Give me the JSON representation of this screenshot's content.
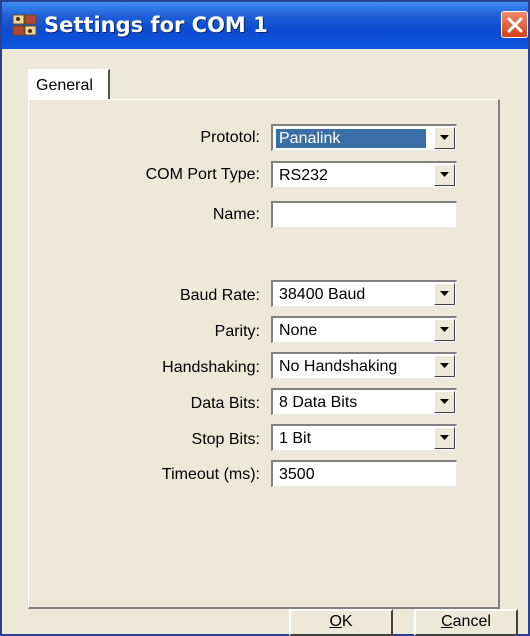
{
  "window": {
    "title": "Settings for COM 1",
    "close_icon": "close-icon",
    "app_icon": "com-port-icon"
  },
  "tabs": [
    {
      "label": "General",
      "active": true
    }
  ],
  "form": {
    "protocol": {
      "label": "Prototol:",
      "value": "Panalink",
      "selected": true
    },
    "com_port_type": {
      "label": "COM Port Type:",
      "value": "RS232"
    },
    "name": {
      "label": "Name:",
      "value": ""
    },
    "baud_rate": {
      "label": "Baud Rate:",
      "value": "38400 Baud"
    },
    "parity": {
      "label": "Parity:",
      "value": "None"
    },
    "handshaking": {
      "label": "Handshaking:",
      "value": "No Handshaking"
    },
    "data_bits": {
      "label": "Data Bits:",
      "value": "8 Data Bits"
    },
    "stop_bits": {
      "label": "Stop Bits:",
      "value": "1 Bit"
    },
    "timeout": {
      "label": "Timeout (ms):",
      "value": "3500"
    }
  },
  "buttons": {
    "ok": {
      "mnemonic": "O",
      "rest": "K"
    },
    "cancel": {
      "mnemonic": "C",
      "rest": "ancel"
    }
  },
  "colors": {
    "title_bar": "#0a4bd0",
    "selection": "#3a6ea5",
    "dialog_bg": "#ece9d8",
    "close_button": "#d6411b"
  }
}
